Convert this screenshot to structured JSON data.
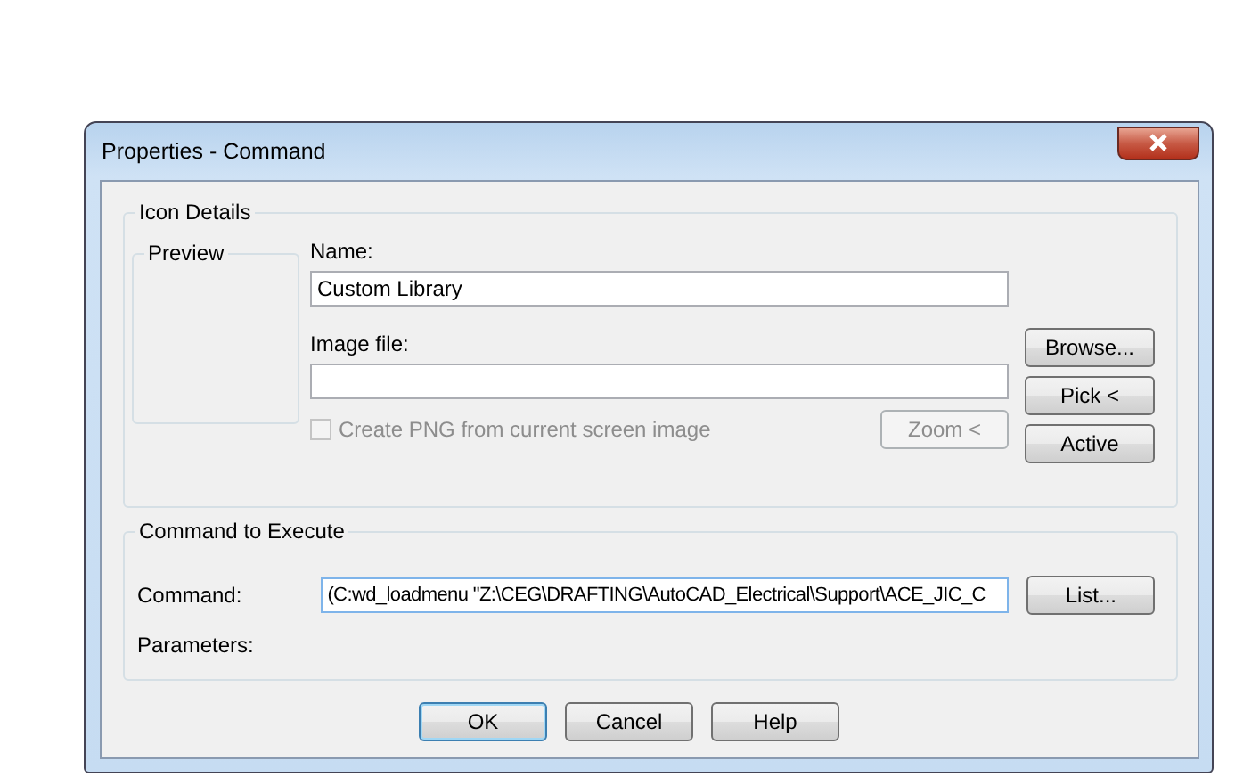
{
  "window": {
    "title": "Properties - Command"
  },
  "icon_details": {
    "title": "Icon Details",
    "preview": {
      "title": "Preview"
    },
    "name": {
      "label": "Name:",
      "value": "Custom Library"
    },
    "image_file": {
      "label": "Image file:"
    },
    "create_png": {
      "label": "Create PNG from current screen image",
      "checked": false,
      "disabled": true
    },
    "zoom_button": {
      "label": "Zoom <",
      "disabled": true
    },
    "side_buttons": [
      {
        "label": "Browse...",
        "disabled": false
      },
      {
        "label": "Pick <",
        "disabled": false
      },
      {
        "label": "Active",
        "disabled": false
      }
    ]
  },
  "command_group": {
    "title": "Command to Execute",
    "command": {
      "label": "Command:",
      "value": "(C:wd_loadmenu \"Z:\\CEG\\DRAFTING\\AutoCAD_Electrical\\Support\\ACE_JIC_C"
    },
    "list_button": {
      "label": "List..."
    },
    "parameters": {
      "label": "Parameters:"
    }
  },
  "buttons": [
    {
      "label": "OK",
      "default": true
    },
    {
      "label": "Cancel",
      "default": false
    },
    {
      "label": "Help",
      "default": false
    }
  ]
}
